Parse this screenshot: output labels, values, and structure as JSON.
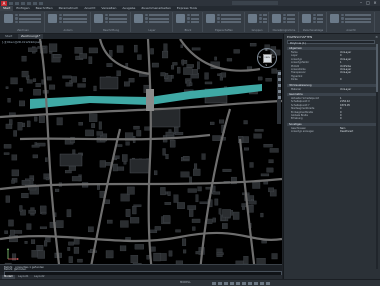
{
  "titlebar": {
    "app_letter": "A"
  },
  "ribbon_tabs": [
    {
      "label": "Start",
      "active": true
    },
    {
      "label": "Einfügen",
      "active": false
    },
    {
      "label": "Beschriften",
      "active": false
    },
    {
      "label": "Parametrisch",
      "active": false
    },
    {
      "label": "Ansicht",
      "active": false
    },
    {
      "label": "Verwalten",
      "active": false
    },
    {
      "label": "Ausgabe",
      "active": false
    },
    {
      "label": "Zusammenarbeiten",
      "active": false
    },
    {
      "label": "Express Tools",
      "active": false
    }
  ],
  "ribbon_groups": [
    "Zeichnen",
    "Ändern",
    "Beschriftung",
    "Layer",
    "Block",
    "Eigenschaften",
    "Gruppen",
    "Dienstprogramme",
    "Zwischenablage",
    "Ansicht"
  ],
  "doc_tabs": [
    {
      "label": "Start",
      "active": false
    },
    {
      "label": "Zeichnung1*",
      "active": true
    }
  ],
  "viewport": {
    "label": "[-][Oben][2D-Drahtkörper]",
    "background": "#000000",
    "river_color": "#3fa9a5",
    "road_color": "#6e6e6e",
    "building_color": "#2a2d30"
  },
  "viewcube": {
    "n": "N",
    "s": "S",
    "w": "W",
    "e": "O",
    "face": "OBEN",
    "wcs": "WKS"
  },
  "command": {
    "lines": [
      "Befehl: _properties  1 gefunden",
      "Befehl: gefunden"
    ],
    "placeholder": "Befehl eingeben"
  },
  "layouts": [
    {
      "label": "Modell",
      "active": true
    },
    {
      "label": "Layout1",
      "active": false
    },
    {
      "label": "Layout2",
      "active": false
    }
  ],
  "status": {
    "coords": "MODELL"
  },
  "palette": {
    "title": "EIGENSCHAFTEN",
    "close": "×",
    "selection": "Polylinie (1)",
    "sections": [
      {
        "title": "Allgemein",
        "rows": [
          {
            "k": "Farbe",
            "v": "VonLayer"
          },
          {
            "k": "Layer",
            "v": "0"
          },
          {
            "k": "Linientyp",
            "v": "VonLayer"
          },
          {
            "k": "Linientypfaktor",
            "v": "1"
          },
          {
            "k": "Plotstil",
            "v": "VonFarbe"
          },
          {
            "k": "Linienstärke",
            "v": "VonLayer"
          },
          {
            "k": "Transparenz",
            "v": "VonLayer"
          },
          {
            "k": "Hyperlink",
            "v": ""
          },
          {
            "k": "Dicke",
            "v": "0"
          }
        ]
      },
      {
        "title": "3D-Visualisierung",
        "rows": [
          {
            "k": "Material",
            "v": "VonLayer"
          }
        ]
      },
      {
        "title": "Geometrie",
        "rows": [
          {
            "k": "Aktueller Scheitelpunkt",
            "v": "1"
          },
          {
            "k": "Scheitelpunkt X",
            "v": "2150.42"
          },
          {
            "k": "Scheitelpunkt Y",
            "v": "1876.05"
          },
          {
            "k": "Startsegmentbreite",
            "v": "0"
          },
          {
            "k": "Endsegmentbreite",
            "v": "0"
          },
          {
            "k": "Globale Breite",
            "v": "0"
          },
          {
            "k": "Erhebung",
            "v": "0"
          }
        ]
      },
      {
        "title": "Sonstiges",
        "rows": [
          {
            "k": "Geschlossen",
            "v": "Nein"
          },
          {
            "k": "Linientyp erzeugen",
            "v": "Deaktiviert"
          }
        ]
      }
    ]
  }
}
